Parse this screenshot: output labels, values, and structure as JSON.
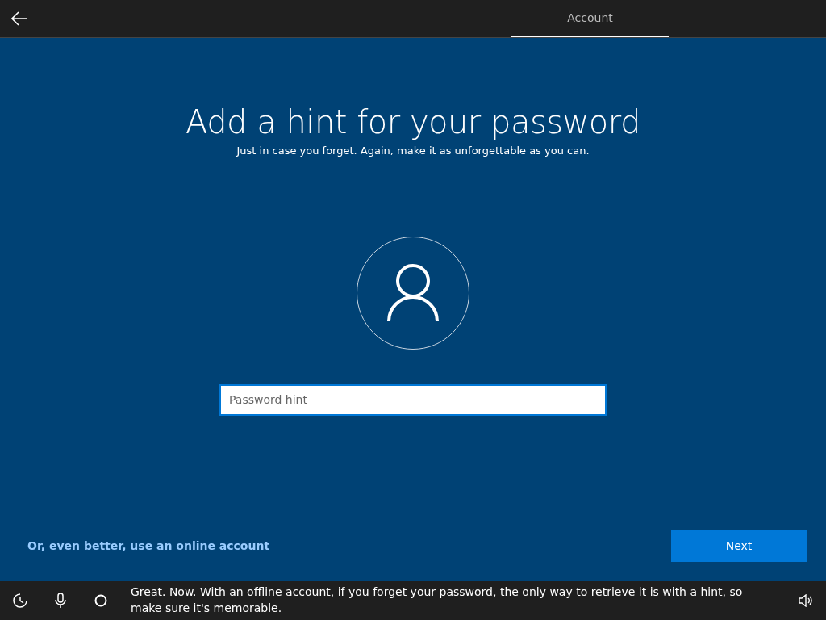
{
  "tabs": [
    {
      "label": "Account",
      "selected": true
    }
  ],
  "title": "Add a hint for your password",
  "subtitle": "Just in case you forget. Again, make it as unforgettable as you can.",
  "hint_field": {
    "placeholder": "Password hint"
  },
  "online_link": "Or, even better, use an online account",
  "next_button": "Next",
  "assistant_caption": "Great. Now. With an offline account, if you forget your password, the only way to retrieve it is with a hint, so make sure it's memorable."
}
